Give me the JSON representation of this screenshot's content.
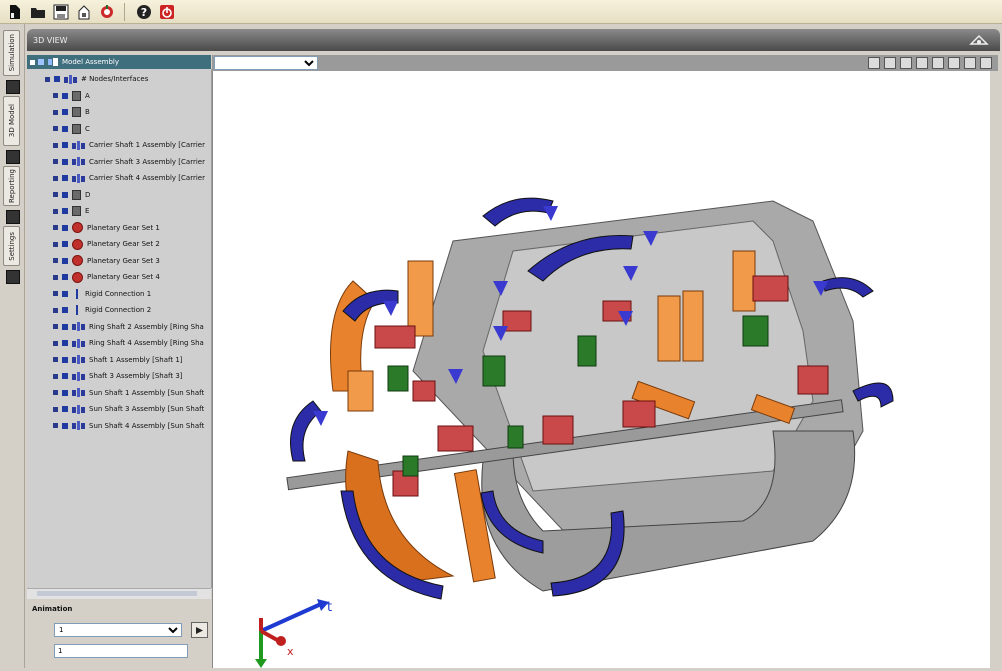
{
  "toolbar": {
    "buttons": [
      "new-model-icon",
      "open-folder-icon",
      "save-icon",
      "export-icon",
      "settings-icon",
      "help-icon",
      "quit-icon"
    ]
  },
  "vertical_tabs": {
    "labels": [
      "Simulation",
      "3D Model",
      "Reporting",
      "Settings"
    ]
  },
  "view": {
    "title": "3D VIEW",
    "selector_value": "",
    "axis_labels": {
      "t": "t",
      "x": "x"
    }
  },
  "tree": {
    "root": "Model Assembly",
    "items": [
      {
        "label": "# Nodes/Interfaces",
        "icon": "assembly",
        "indent": 1
      },
      {
        "label": "A",
        "icon": "box",
        "indent": 2
      },
      {
        "label": "B",
        "icon": "box",
        "indent": 2
      },
      {
        "label": "C",
        "icon": "box",
        "indent": 2
      },
      {
        "label": "Carrier Shaft 1 Assembly [Carrier",
        "icon": "assembly",
        "indent": 2
      },
      {
        "label": "Carrier Shaft 3 Assembly [Carrier",
        "icon": "assembly",
        "indent": 2
      },
      {
        "label": "Carrier Shaft 4 Assembly [Carrier",
        "icon": "assembly",
        "indent": 2
      },
      {
        "label": "D",
        "icon": "box",
        "indent": 2
      },
      {
        "label": "E",
        "icon": "box",
        "indent": 2
      },
      {
        "label": "Planetary Gear Set 1",
        "icon": "gear",
        "indent": 2
      },
      {
        "label": "Planetary Gear Set 2",
        "icon": "gear",
        "indent": 2
      },
      {
        "label": "Planetary Gear Set 3",
        "icon": "gear",
        "indent": 2
      },
      {
        "label": "Planetary Gear Set 4",
        "icon": "gear",
        "indent": 2
      },
      {
        "label": "Rigid Connection 1",
        "icon": "connection",
        "indent": 2
      },
      {
        "label": "Rigid Connection 2",
        "icon": "connection",
        "indent": 2
      },
      {
        "label": "Ring Shaft 2 Assembly [Ring Sha",
        "icon": "assembly",
        "indent": 2
      },
      {
        "label": "Ring Shaft 4 Assembly [Ring Sha",
        "icon": "assembly",
        "indent": 2
      },
      {
        "label": "Shaft 1 Assembly [Shaft 1]",
        "icon": "assembly",
        "indent": 2
      },
      {
        "label": "Shaft 3 Assembly [Shaft 3]",
        "icon": "assembly",
        "indent": 2
      },
      {
        "label": "Sun Shaft 1 Assembly [Sun Shaft",
        "icon": "assembly",
        "indent": 2
      },
      {
        "label": "Sun Shaft 3 Assembly [Sun Shaft",
        "icon": "assembly",
        "indent": 2
      },
      {
        "label": "Sun Shaft 4 Assembly [Sun Shaft",
        "icon": "assembly",
        "indent": 2
      }
    ]
  },
  "animation": {
    "title": "Animation",
    "select_value": "1",
    "field_value": "1"
  },
  "colors": {
    "housing": "#b4b4b4",
    "ring": "#e8822c",
    "arrow": "#2c2ca8",
    "gear": "#c9484a",
    "green": "#2a7a2a"
  }
}
